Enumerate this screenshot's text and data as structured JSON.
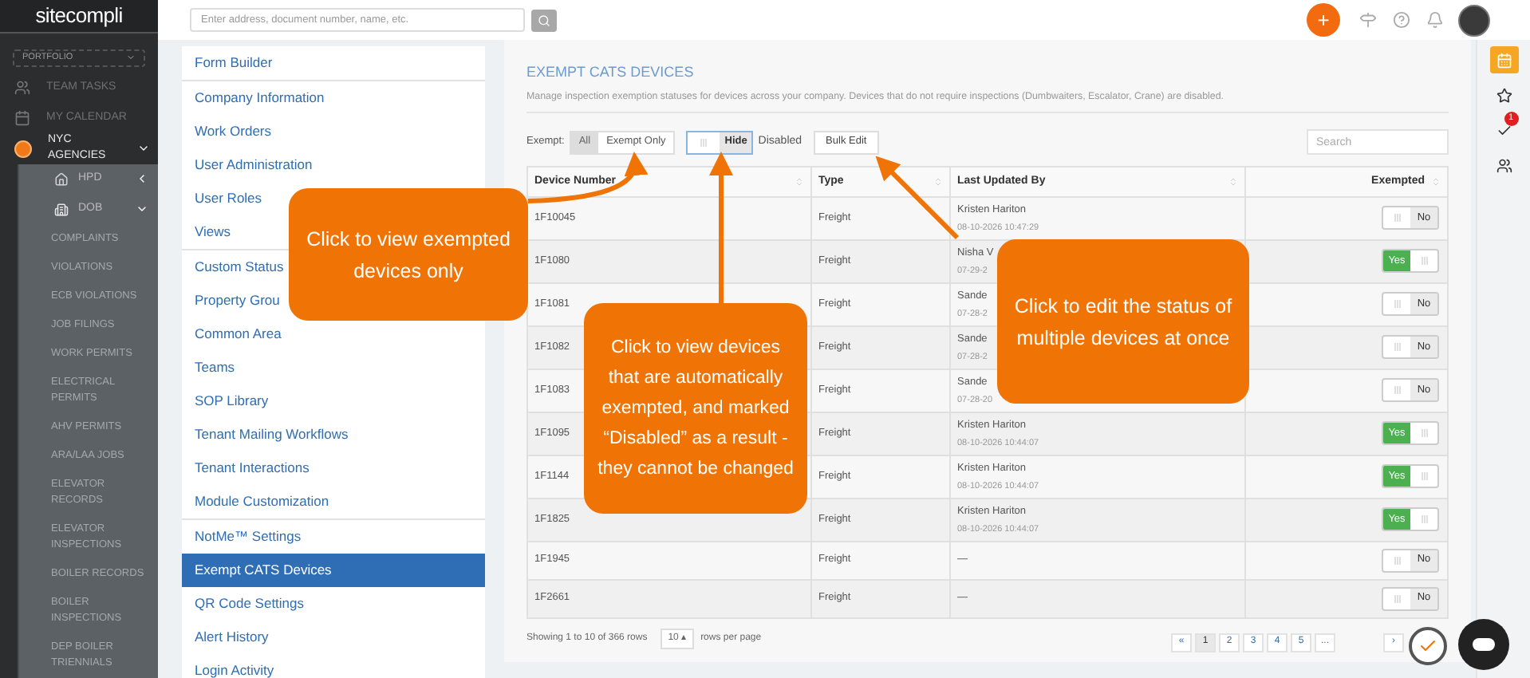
{
  "sidebar": {
    "logo": "sitecompli",
    "portfolio": "PORTFOLIO",
    "items": [
      {
        "label": "TEAM TASKS"
      },
      {
        "label": "MY CALENDAR"
      },
      {
        "label": "NYC AGENCIES",
        "expanded": true,
        "children": [
          {
            "label": "HPD",
            "expanded": false
          },
          {
            "label": "DOB",
            "expanded": true,
            "children": [
              {
                "label": "COMPLAINTS"
              },
              {
                "label": "VIOLATIONS"
              },
              {
                "label": "ECB VIOLATIONS"
              },
              {
                "label": "JOB FILINGS"
              },
              {
                "label": "WORK PERMITS"
              },
              {
                "label": "ELECTRICAL PERMITS"
              },
              {
                "label": "AHV PERMITS"
              },
              {
                "label": "ARA/LAA JOBS"
              },
              {
                "label": "ELEVATOR RECORDS"
              },
              {
                "label": "ELEVATOR INSPECTIONS"
              },
              {
                "label": "BOILER RECORDS"
              },
              {
                "label": "BOILER INSPECTIONS"
              },
              {
                "label": "DEP BOILER TRIENNIALS"
              }
            ]
          }
        ]
      }
    ]
  },
  "topbar": {
    "search": {
      "placeholder": "Enter address, document number, name, etc."
    },
    "add": "+"
  },
  "settings_nav": [
    [
      {
        "label": "Form Builder",
        "selected": false
      }
    ],
    [
      {
        "label": "Company Information",
        "selected": false
      },
      {
        "label": "Work Orders",
        "selected": false
      },
      {
        "label": "User Administration",
        "selected": false
      },
      {
        "label": "User Roles",
        "selected": false
      },
      {
        "label": "Views",
        "selected": false
      }
    ],
    [
      {
        "label": "Custom Status",
        "selected": false
      },
      {
        "label": "Property Grou",
        "selected": false
      },
      {
        "label": "Common Area",
        "selected": false
      },
      {
        "label": "Teams",
        "selected": false
      },
      {
        "label": "SOP Library",
        "selected": false
      },
      {
        "label": "Tenant Mailing Workflows",
        "selected": false
      },
      {
        "label": "Tenant Interactions",
        "selected": false
      },
      {
        "label": "Module Customization",
        "selected": false
      }
    ],
    [
      {
        "label": "NotMe™ Settings",
        "selected": false
      },
      {
        "label": "Exempt CATS Devices",
        "selected": true
      },
      {
        "label": "QR Code Settings",
        "selected": false
      },
      {
        "label": "Alert History",
        "selected": false
      },
      {
        "label": "Login Activity",
        "selected": false
      }
    ]
  ],
  "main": {
    "title": "EXEMPT CATS DEVICES",
    "description": "Manage inspection exemption statuses for devices across your company. Devices that do not require inspections (Dumbwaiters, Escalator, Crane) are disabled.",
    "exempt_label": "Exempt:",
    "exempt_filter": [
      {
        "label": "All",
        "selected": true
      },
      {
        "label": "Exempt Only",
        "selected": false
      }
    ],
    "disabled_toggle": {
      "label": "Hide",
      "on": true
    },
    "disabled_label": "Disabled",
    "bulk_edit": "Bulk Edit",
    "search": {
      "placeholder": "Search"
    },
    "table": {
      "columns": [
        "Device Number",
        "Type",
        "Last Updated By",
        "Exempted"
      ],
      "rows": [
        {
          "device": "1F10045",
          "type": "Freight",
          "user": "Kristen Hariton",
          "date": "08-10-2026 10:47:29",
          "exempted": false,
          "switch_label": "No"
        },
        {
          "device": "1F1080",
          "type": "Freight",
          "user": "Nisha V",
          "date": "07-29-2",
          "exempted": true,
          "switch_label": "Yes"
        },
        {
          "device": "1F1081",
          "type": "Freight",
          "user": "Sande",
          "date": "07-28-2",
          "exempted": false,
          "switch_label": "No"
        },
        {
          "device": "1F1082",
          "type": "Freight",
          "user": "Sande",
          "date": "07-28-2",
          "exempted": false,
          "switch_label": "No"
        },
        {
          "device": "1F1083",
          "type": "Freight",
          "user": "Sande",
          "date": "07-28-20",
          "exempted": false,
          "switch_label": "No"
        },
        {
          "device": "1F1095",
          "type": "Freight",
          "user": "Kristen Hariton",
          "date": "08-10-2026 10:44:07",
          "exempted": true,
          "switch_label": "Yes"
        },
        {
          "device": "1F1144",
          "type": "Freight",
          "user": "Kristen Hariton",
          "date": "08-10-2026 10:44:07",
          "exempted": true,
          "switch_label": "Yes"
        },
        {
          "device": "1F1825",
          "type": "Freight",
          "user": "Kristen Hariton",
          "date": "08-10-2026 10:44:07",
          "exempted": true,
          "switch_label": "Yes"
        },
        {
          "device": "1F1945",
          "type": "Freight",
          "user": "—",
          "exempted": false,
          "switch_label": "No"
        },
        {
          "device": "1F2661",
          "type": "Freight",
          "user": "—",
          "exempted": false,
          "switch_label": "No"
        }
      ]
    },
    "footer": {
      "showing": "Showing 1 to 10 of 366 rows",
      "page_size": "10 ▴",
      "per_page": "rows per page"
    },
    "pagination": [
      {
        "label": "«",
        "selected": false
      },
      {
        "label": "1",
        "selected": true
      },
      {
        "label": "2",
        "selected": false
      },
      {
        "label": "3",
        "selected": false
      },
      {
        "label": "4",
        "selected": false
      },
      {
        "label": "5",
        "selected": false
      },
      {
        "label": "...",
        "selected": false
      },
      {
        "label": "›",
        "selected": false
      }
    ]
  },
  "right_rail": [
    {
      "selected": true
    },
    {
      "selected": false
    },
    {
      "selected": false,
      "badge": "1"
    },
    {
      "selected": false
    }
  ],
  "callouts": [
    "Click to view exempted devices only",
    "Click to view devices that are automatically exempted, and marked “Disabled” as a result - they cannot be changed",
    "Click to edit the status of multiple devices at once"
  ]
}
